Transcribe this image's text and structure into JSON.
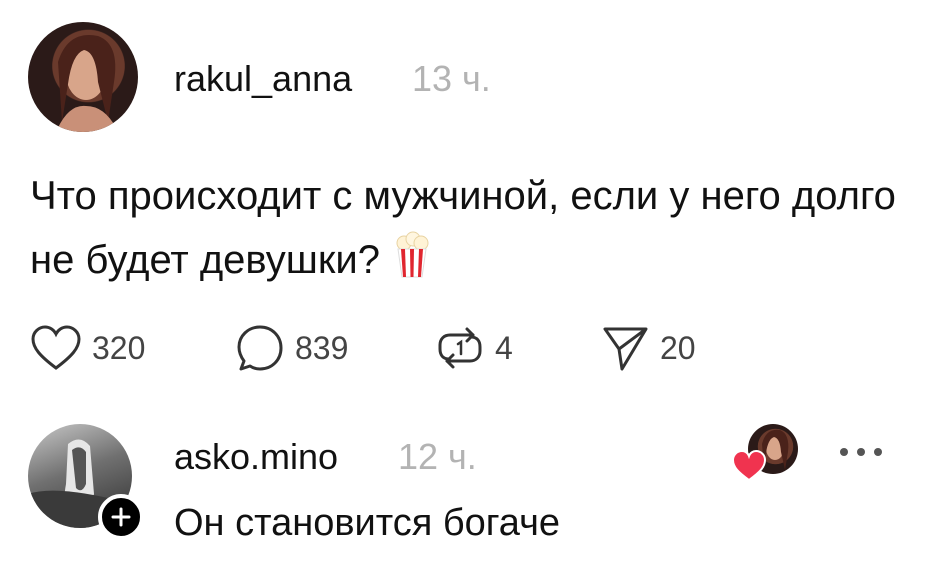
{
  "post": {
    "username": "rakul_anna",
    "time": "13 ч.",
    "text": "Что происходит с мужчиной, если у него долго не будет девушки?",
    "emoji_icon": "popcorn-icon"
  },
  "actions": {
    "likes": "320",
    "comments": "839",
    "reposts": "4",
    "shares": "20"
  },
  "reply": {
    "username": "asko.mino",
    "time": "12 ч.",
    "text": "Он становится богаче"
  },
  "colors": {
    "heart": "#f0334f",
    "muted": "#b3b3b3"
  }
}
